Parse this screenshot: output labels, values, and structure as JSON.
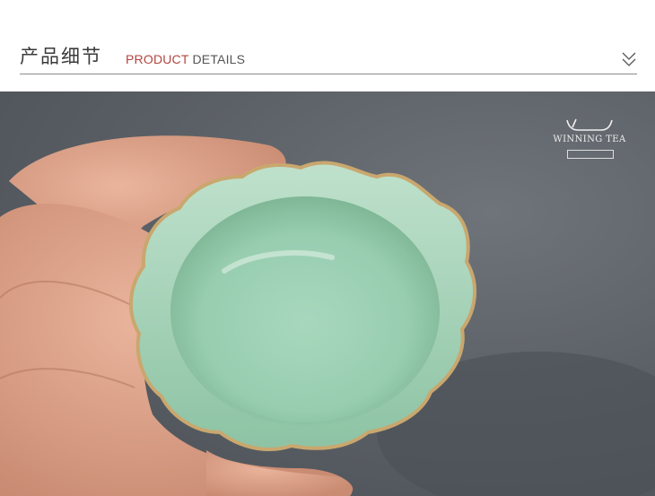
{
  "header": {
    "title_cn": "产品细节",
    "title_en_accent": "PRODUCT",
    "title_en_rest": "DETAILS",
    "chevron_icon": "double-chevron-down-icon"
  },
  "logo": {
    "brand_text": "WINNING TEA"
  },
  "colors": {
    "accent": "#b0463f",
    "glaze": "#9ed0b4",
    "background": "#5c6167"
  }
}
